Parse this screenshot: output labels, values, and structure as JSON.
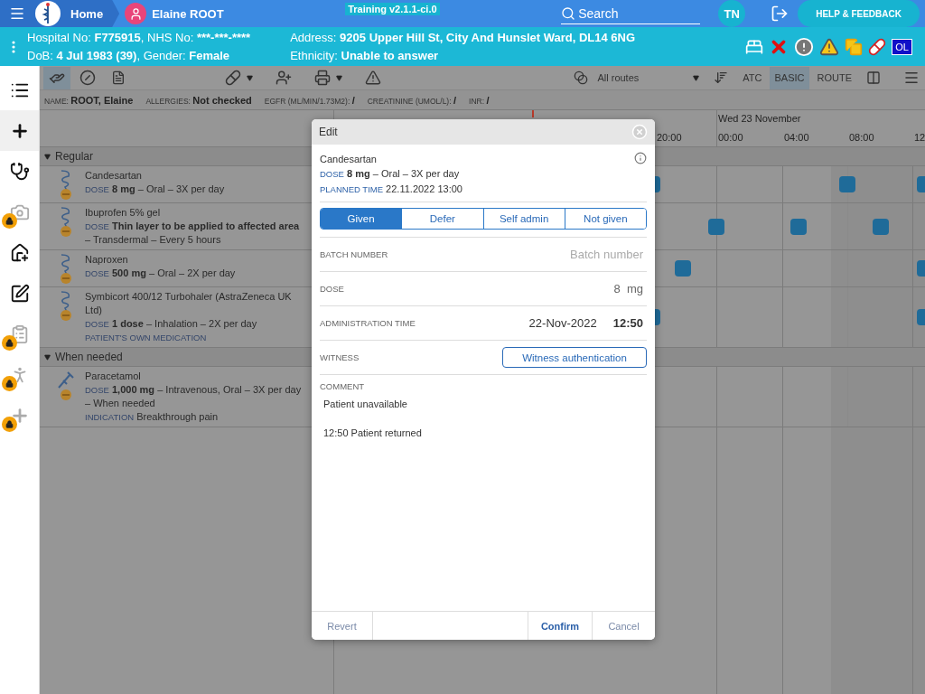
{
  "header": {
    "home": "Home",
    "patient": "Elaine ROOT",
    "build": "Training v2.1.1-ci.0",
    "search": {
      "placeholder": "Search"
    },
    "user_initials": "TN",
    "help_button": "HELP & FEEDBACK"
  },
  "banner": {
    "left": [
      [
        {
          "label": "Hospital No:",
          "value": "F775915"
        },
        {
          "label": ", NHS No:",
          "value": "***-***-****"
        }
      ],
      [
        {
          "label": "DoB:",
          "value": "4 Jul 1983 (39)"
        },
        {
          "label": ", Gender:",
          "value": "Female"
        }
      ]
    ],
    "right": [
      [
        {
          "label": "Address:",
          "value": "9205 Upper Hill St, City And Hunslet Ward, DL14 6NG"
        }
      ],
      [
        {
          "label": "Ethnicity:",
          "value": "Unable to answer"
        }
      ]
    ],
    "alerts": [
      {
        "kind": "bed"
      },
      {
        "kind": "cross"
      },
      {
        "kind": "exclamation"
      },
      {
        "kind": "warning"
      },
      {
        "kind": "copies"
      },
      {
        "kind": "pill"
      },
      {
        "kind": "badge",
        "label": "OL"
      }
    ]
  },
  "sidebar": {
    "items": [
      {
        "kind": "list",
        "locked": false,
        "selected": false
      },
      {
        "kind": "add",
        "locked": false,
        "selected": true
      },
      {
        "kind": "stethoscope",
        "locked": false,
        "selected": false
      },
      {
        "kind": "camera",
        "locked": true,
        "selected": false
      },
      {
        "kind": "house",
        "locked": false,
        "selected": false
      },
      {
        "kind": "sign",
        "locked": false,
        "selected": false
      },
      {
        "kind": "clipboard",
        "locked": true,
        "selected": false
      },
      {
        "kind": "walk",
        "locked": true,
        "selected": false
      },
      {
        "kind": "add",
        "locked": true,
        "selected": false
      }
    ]
  },
  "toolbar": {
    "views": [
      {
        "kind": "administer",
        "selected": true
      },
      {
        "kind": "pill",
        "selected": false
      },
      {
        "kind": "document",
        "selected": false
      }
    ],
    "tools": [
      {
        "kind": "add-drug",
        "dropdown": true
      },
      {
        "kind": "add-ref",
        "dropdown": false
      },
      {
        "kind": "print",
        "dropdown": true
      },
      {
        "kind": "warning",
        "dropdown": false
      }
    ],
    "route_filter": "All routes",
    "sort_modes": [
      {
        "label": "ATC",
        "selected": false
      },
      {
        "label": "BASIC",
        "selected": true
      },
      {
        "label": "ROUTE",
        "selected": false
      }
    ]
  },
  "patient_info": [
    {
      "label": "NAME:",
      "value": "ROOT, Elaine"
    },
    {
      "label": "ALLERGIES:",
      "value": "Not checked"
    },
    {
      "label": "EGFR (ML/MIN/1.73M2):",
      "value": "/"
    },
    {
      "label": "CREATININE (UMOL/L):",
      "value": "/"
    },
    {
      "label": "INR:",
      "value": "/"
    }
  ],
  "timeline": {
    "day": "Wed 23 November",
    "times": [
      "20:00",
      "00:00",
      "04:00",
      "08:00",
      "12"
    ]
  },
  "groups": [
    {
      "title": "Regular",
      "expanded": true,
      "medications": [
        {
          "kind": "swirl",
          "name": "Candesartan",
          "dose_label": "DOSE",
          "dose": "**8 mg** – Oral – 3X per day"
        },
        {
          "kind": "swirl",
          "name": "Ibuprofen 5% gel",
          "dose_label": "DOSE",
          "dose": "**Thin layer to be applied to affected area** – Transdermal – Every 5 hours"
        },
        {
          "kind": "swirl",
          "name": "Naproxen",
          "dose_label": "DOSE",
          "dose": "**500 mg** – Oral – 2X per day"
        },
        {
          "kind": "swirl",
          "name": "Symbicort 400/12 Turbohaler (AstraZeneca UK Ltd)",
          "dose_label": "DOSE",
          "dose": "**1 dose** – Inhalation – 2X per day",
          "note": "PATIENT'S OWN MEDICATION"
        }
      ]
    },
    {
      "title": "When needed",
      "expanded": true,
      "medications": [
        {
          "kind": "syringe",
          "name": "Paracetamol",
          "dose_label": "DOSE",
          "dose": "**1,000 mg** – Intravenous, Oral – 3X per day – When needed",
          "indication_label": "INDICATION",
          "indication": "Breakthrough pain"
        }
      ]
    }
  ],
  "dialog": {
    "title": "Edit",
    "drug": "Candesartan",
    "dose_label": "DOSE",
    "dose": "**8 mg** – Oral – 3X per day",
    "planned_label": "PLANNED TIME",
    "planned": "22.11.2022 13:00",
    "outcomes": [
      {
        "label": "Given",
        "selected": true
      },
      {
        "label": "Defer",
        "selected": false
      },
      {
        "label": "Self admin",
        "selected": false
      },
      {
        "label": "Not given",
        "selected": false
      }
    ],
    "fields": [
      {
        "kind": "input",
        "label": "BATCH NUMBER",
        "placeholder": "Batch number"
      },
      {
        "kind": "quantity",
        "label": "DOSE",
        "value": "8",
        "unit": "mg"
      },
      {
        "kind": "datetime",
        "label": "ADMINISTRATION TIME",
        "date": "22-Nov-2022",
        "time": "12:50"
      },
      {
        "kind": "button",
        "label": "WITNESS",
        "button": "Witness authentication"
      }
    ],
    "comment": {
      "label": "COMMENT",
      "value": "Patient unavailable\n\n12:50 Patient returned"
    },
    "footer": {
      "revert": "Revert",
      "confirm": "Confirm",
      "cancel": "Cancel"
    }
  }
}
